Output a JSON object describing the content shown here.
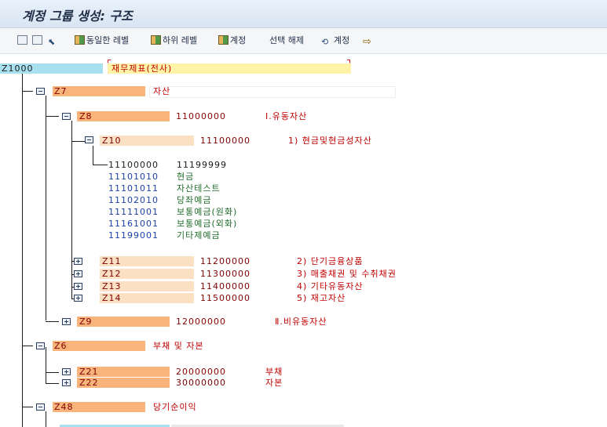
{
  "title": "계정 그룹 생성: 구조",
  "toolbar": {
    "same_level": "동일한 레벨",
    "sub_level": "하위 레벨",
    "account": "계정",
    "deselect": "선택 해제",
    "account2": "계정"
  },
  "root": {
    "code": "Z1000",
    "text": "재무제표(전사)"
  },
  "z7": {
    "code": "Z7",
    "text": "자산"
  },
  "z8": {
    "code": "Z8",
    "from": "11000000",
    "text": "Ⅰ.유동자산"
  },
  "z10": {
    "code": "Z10",
    "from": "11100000",
    "text": "1) 현금및현금성자산"
  },
  "range": {
    "from": "11100000",
    "to": "11199999"
  },
  "leaves": [
    {
      "code": "11101010",
      "text": "현금"
    },
    {
      "code": "11101011",
      "text": "자산테스트"
    },
    {
      "code": "11102010",
      "text": "당좌예금"
    },
    {
      "code": "11111001",
      "text": "보통예금(원화)"
    },
    {
      "code": "11161001",
      "text": "보통예금(외화)"
    },
    {
      "code": "11199001",
      "text": "기타제예금"
    }
  ],
  "z11": {
    "code": "Z11",
    "from": "11200000",
    "text": "2) 단기금융상품"
  },
  "z12": {
    "code": "Z12",
    "from": "11300000",
    "text": "3) 매출채권 및 수취채권"
  },
  "z13": {
    "code": "Z13",
    "from": "11400000",
    "text": "4) 기타유동자산"
  },
  "z14": {
    "code": "Z14",
    "from": "11500000",
    "text": "5) 재고자산"
  },
  "z9": {
    "code": "Z9",
    "from": "12000000",
    "text": "Ⅱ.비유동자산"
  },
  "z6": {
    "code": "Z6",
    "text": "부채 및 자본"
  },
  "z21": {
    "code": "Z21",
    "from": "20000000",
    "text": "부채"
  },
  "z22": {
    "code": "Z22",
    "from": "30000000",
    "text": "자본"
  },
  "z48": {
    "code": "Z48",
    "text": "당기순이익"
  },
  "colors": {
    "orange": "#f8b47a",
    "peach": "#fbe0c4",
    "cyan": "#a8e0f0",
    "yellow": "#fff3a8"
  }
}
